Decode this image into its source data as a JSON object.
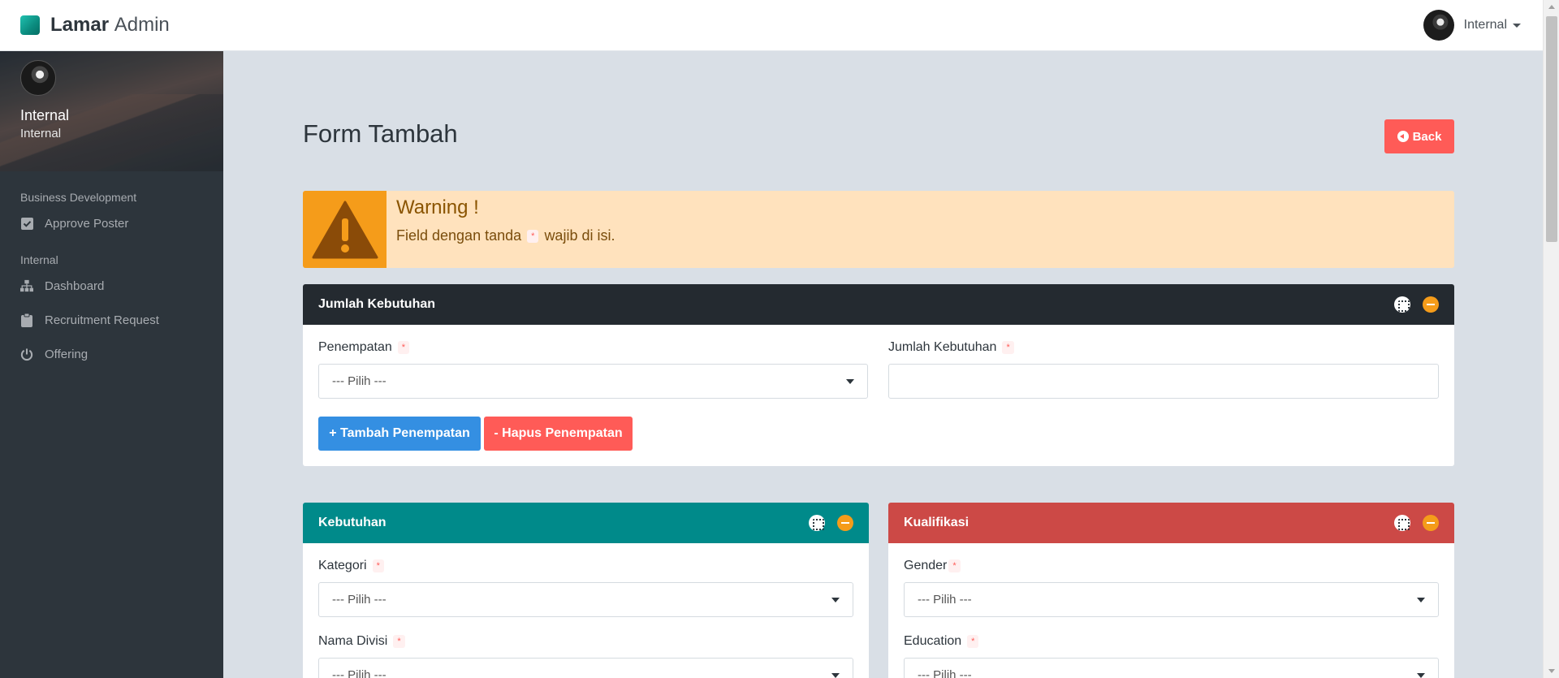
{
  "header": {
    "brand_bold": "Lamar",
    "brand_light": "Admin",
    "user_name": "Internal"
  },
  "sidebar": {
    "profile_name": "Internal",
    "profile_role": "Internal",
    "sections": [
      {
        "title": "Business Development",
        "items": [
          {
            "label": "Approve Poster",
            "icon": "check-square-icon"
          }
        ]
      },
      {
        "title": "Internal",
        "items": [
          {
            "label": "Dashboard",
            "icon": "sitemap-icon"
          },
          {
            "label": "Recruitment Request",
            "icon": "clipboard-icon"
          },
          {
            "label": "Offering",
            "icon": "power-icon"
          }
        ]
      }
    ]
  },
  "page": {
    "title": "Form Tambah",
    "back_label": "Back"
  },
  "warning": {
    "title": "Warning !",
    "text_before": "Field dengan tanda",
    "star": "*",
    "text_after": "wajib di isi."
  },
  "panels": {
    "jumlah": {
      "title": "Jumlah Kebutuhan",
      "penempatan_label": "Penempatan",
      "penempatan_value": "--- Pilih ---",
      "jumlah_label": "Jumlah Kebutuhan",
      "add_label": "+ Tambah Penempatan",
      "remove_label": "- Hapus Penempatan"
    },
    "kebutuhan": {
      "title": "Kebutuhan",
      "kategori_label": "Kategori",
      "kategori_value": "--- Pilih ---",
      "divisi_label": "Nama Divisi",
      "divisi_value": "--- Pilih ---"
    },
    "kualifikasi": {
      "title": "Kualifikasi",
      "gender_label": "Gender",
      "gender_value": "--- Pilih ---",
      "education_label": "Education",
      "education_value": "--- Pilih ---"
    }
  },
  "required_mark": "*",
  "colors": {
    "primary": "#348fe2",
    "danger": "#ff5b57",
    "teal": "#008a8a",
    "red_panel": "#cc4946",
    "dark_panel": "#242a30",
    "warning": "#f59c1a"
  }
}
